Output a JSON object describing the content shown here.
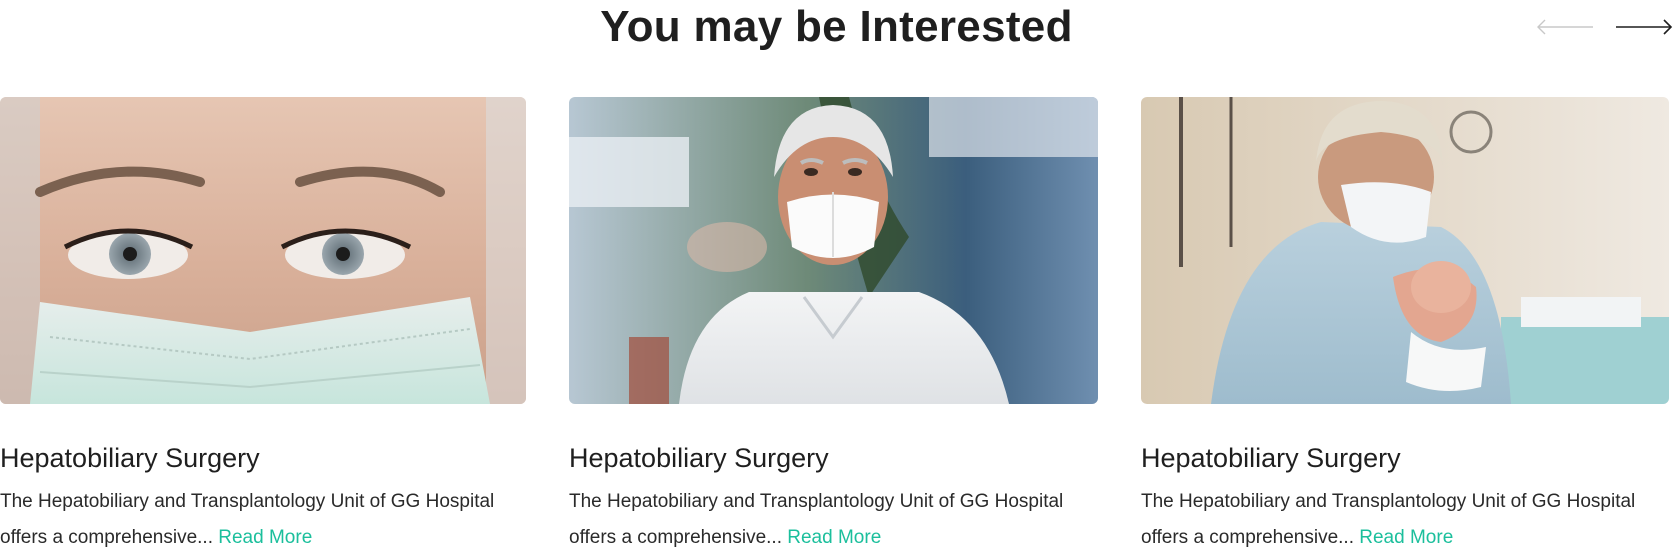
{
  "section": {
    "title": "You may be Interested"
  },
  "carousel": {
    "prev_icon": "arrow-left-icon",
    "next_icon": "arrow-right-icon",
    "prev_color": "#c8c8c8",
    "next_color": "#1f1f1f"
  },
  "cards": [
    {
      "title": "Hepatobiliary Surgery",
      "description": "The Hepatobiliary and Transplantology Unit of GG Hospital offers a comprehensive...",
      "link_label": "Read More",
      "image": "nurse-in-surgical-mask-photo"
    },
    {
      "title": "Hepatobiliary Surgery",
      "description": "The Hepatobiliary and Transplantology Unit of GG Hospital offers a comprehensive...",
      "link_label": "Read More",
      "image": "man-in-n95-mask-photo"
    },
    {
      "title": "Hepatobiliary Surgery",
      "description": "The Hepatobiliary and Transplantology Unit of GG Hospital offers a comprehensive...",
      "link_label": "Read More",
      "image": "doctor-holding-newborn-photo"
    }
  ],
  "colors": {
    "accent": "#1bbf9c",
    "heading": "#1f1f1f",
    "body_text": "#2a2a2a"
  }
}
